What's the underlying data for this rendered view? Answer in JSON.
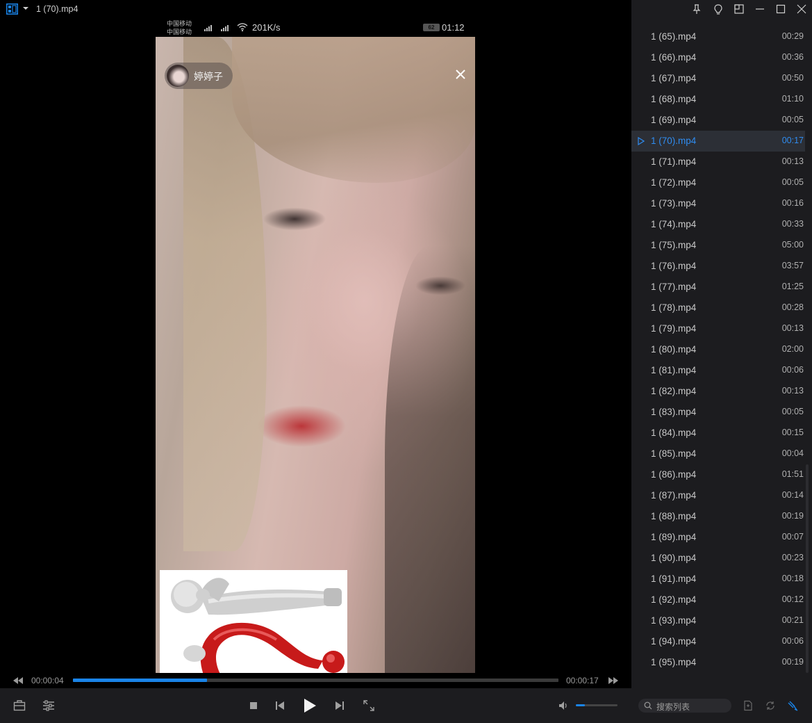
{
  "window": {
    "title": "1 (70).mp4"
  },
  "video": {
    "status_bar": {
      "carrier_line1": "中国移动",
      "carrier_line2": "中国移动",
      "net_speed": "201K/s",
      "battery": "62",
      "time": "01:12"
    },
    "streamer_name": "婷婷子"
  },
  "progress": {
    "current": "00:00:04",
    "total": "00:00:17",
    "fraction": 0.276
  },
  "volume": {
    "fraction": 0.22
  },
  "playlist": {
    "active_index": 5,
    "items": [
      {
        "name": "1 (65).mp4",
        "duration": "00:29"
      },
      {
        "name": "1 (66).mp4",
        "duration": "00:36"
      },
      {
        "name": "1 (67).mp4",
        "duration": "00:50"
      },
      {
        "name": "1 (68).mp4",
        "duration": "01:10"
      },
      {
        "name": "1 (69).mp4",
        "duration": "00:05"
      },
      {
        "name": "1 (70).mp4",
        "duration": "00:17"
      },
      {
        "name": "1 (71).mp4",
        "duration": "00:13"
      },
      {
        "name": "1 (72).mp4",
        "duration": "00:05"
      },
      {
        "name": "1 (73).mp4",
        "duration": "00:16"
      },
      {
        "name": "1 (74).mp4",
        "duration": "00:33"
      },
      {
        "name": "1 (75).mp4",
        "duration": "05:00"
      },
      {
        "name": "1 (76).mp4",
        "duration": "03:57"
      },
      {
        "name": "1 (77).mp4",
        "duration": "01:25"
      },
      {
        "name": "1 (78).mp4",
        "duration": "00:28"
      },
      {
        "name": "1 (79).mp4",
        "duration": "00:13"
      },
      {
        "name": "1 (80).mp4",
        "duration": "02:00"
      },
      {
        "name": "1 (81).mp4",
        "duration": "00:06"
      },
      {
        "name": "1 (82).mp4",
        "duration": "00:13"
      },
      {
        "name": "1 (83).mp4",
        "duration": "00:05"
      },
      {
        "name": "1 (84).mp4",
        "duration": "00:15"
      },
      {
        "name": "1 (85).mp4",
        "duration": "00:04"
      },
      {
        "name": "1 (86).mp4",
        "duration": "01:51"
      },
      {
        "name": "1 (87).mp4",
        "duration": "00:14"
      },
      {
        "name": "1 (88).mp4",
        "duration": "00:19"
      },
      {
        "name": "1 (89).mp4",
        "duration": "00:07"
      },
      {
        "name": "1 (90).mp4",
        "duration": "00:23"
      },
      {
        "name": "1 (91).mp4",
        "duration": "00:18"
      },
      {
        "name": "1 (92).mp4",
        "duration": "00:12"
      },
      {
        "name": "1 (93).mp4",
        "duration": "00:21"
      },
      {
        "name": "1 (94).mp4",
        "duration": "00:06"
      },
      {
        "name": "1 (95).mp4",
        "duration": "00:19"
      }
    ]
  },
  "search": {
    "placeholder": "搜索列表"
  },
  "colors": {
    "accent": "#1a84e8",
    "active_text": "#2f8cf0",
    "sidebar_bg": "#1c1c1f"
  },
  "icons": {
    "app_logo": "app-logo-icon",
    "pin": "pin-icon",
    "skin": "skin-icon",
    "mini_mode": "mini-mode-icon",
    "minimize": "minimize-icon",
    "maximize": "maximize-icon",
    "close": "close-icon"
  }
}
